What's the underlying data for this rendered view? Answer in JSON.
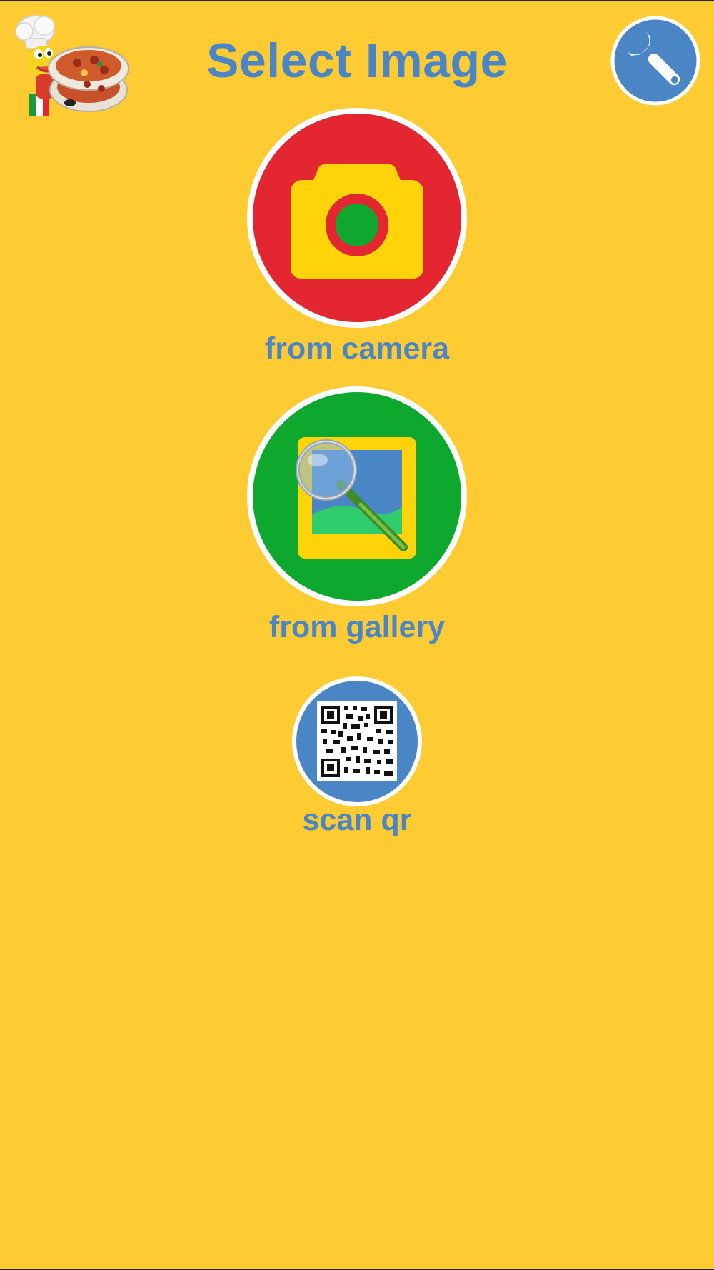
{
  "header": {
    "title": "Select Image"
  },
  "options": {
    "camera": {
      "label": "from camera",
      "icon": "camera-icon"
    },
    "gallery": {
      "label": "from gallery",
      "icon": "gallery-search-icon"
    },
    "qr": {
      "label": "scan qr",
      "icon": "qr-code-icon"
    }
  },
  "icons": {
    "settings": "wrench-icon",
    "logo": "chef-mascot-pizza-logo"
  },
  "colors": {
    "background": "#FFCB33",
    "text_accent": "#4A86C5",
    "camera_circle": "#E32630",
    "gallery_circle": "#0FA82E",
    "qr_circle": "#4A86C5",
    "settings_circle": "#4A86C5"
  }
}
